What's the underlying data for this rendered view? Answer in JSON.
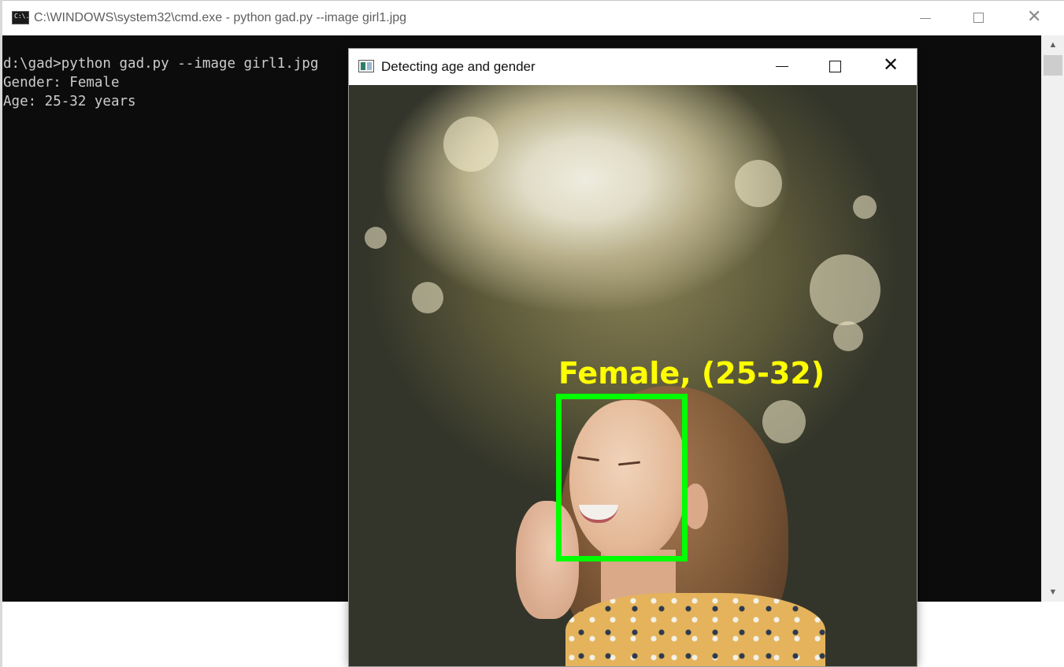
{
  "cmd_window": {
    "title": "C:\\WINDOWS\\system32\\cmd.exe - python  gad.py --image girl1.jpg",
    "icon": "cmd-icon",
    "icon_text": "C:\\.",
    "controls": {
      "minimize": "minimize-icon",
      "maximize": "maximize-icon",
      "close": "close-icon"
    },
    "console_lines": [
      "d:\\gad>python gad.py --image girl1.jpg",
      "Gender: Female",
      "Age: 25-32 years"
    ],
    "console_colors": {
      "background": "#0c0c0c",
      "text": "#cccccc"
    }
  },
  "image_window": {
    "title": "Detecting age and gender",
    "icon": "opencv-window-icon",
    "controls": {
      "minimize": "minimize-icon",
      "maximize": "maximize-icon",
      "close": "close-icon"
    },
    "detection": {
      "label": "Female, (25-32)",
      "box_color": "#00ff00",
      "label_color": "#ffff00"
    }
  }
}
